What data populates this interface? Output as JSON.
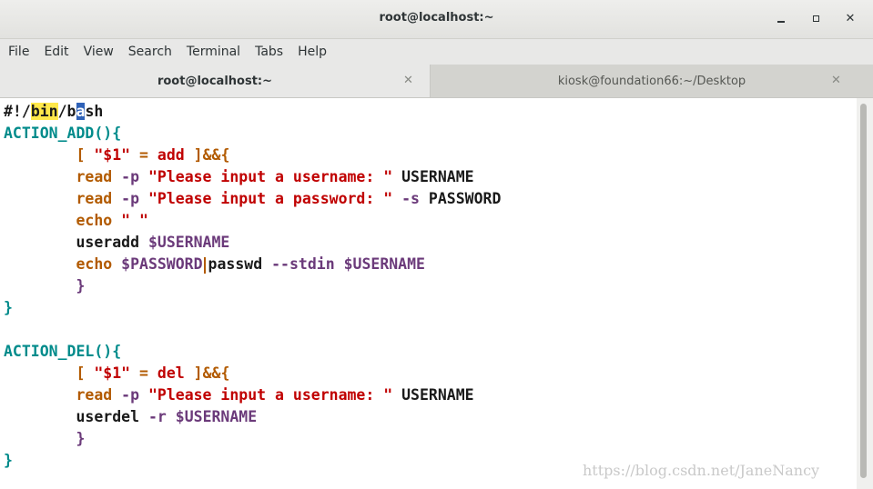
{
  "window": {
    "title": "root@localhost:~",
    "controls": {
      "minimize": "minimize-icon",
      "maximize": "maximize-icon",
      "close": "close-icon"
    }
  },
  "menu": [
    "File",
    "Edit",
    "View",
    "Search",
    "Terminal",
    "Tabs",
    "Help"
  ],
  "tabs": [
    {
      "label": "root@localhost:~",
      "active": true
    },
    {
      "label": "kiosk@foundation66:~/Desktop",
      "active": false
    }
  ],
  "code_lines": [
    [
      {
        "t": "#!/",
        "c": "black"
      },
      {
        "t": "bin",
        "c": "bin"
      },
      {
        "t": "/b",
        "c": "black"
      },
      {
        "t": "a",
        "c": "cursor"
      },
      {
        "t": "sh",
        "c": "black"
      }
    ],
    [
      {
        "t": "ACTION_ADD(){",
        "c": "teal"
      }
    ],
    [
      {
        "t": "        [ ",
        "c": "orange"
      },
      {
        "t": "\"$1\"",
        "c": "red"
      },
      {
        "t": " = ",
        "c": "orange"
      },
      {
        "t": "add",
        "c": "red"
      },
      {
        "t": " ]&&{",
        "c": "orange"
      }
    ],
    [
      {
        "t": "        read ",
        "c": "orange"
      },
      {
        "t": "-p ",
        "c": "purple"
      },
      {
        "t": "\"Please input a username: \"",
        "c": "red"
      },
      {
        "t": " USERNAME",
        "c": "black"
      }
    ],
    [
      {
        "t": "        read ",
        "c": "orange"
      },
      {
        "t": "-p ",
        "c": "purple"
      },
      {
        "t": "\"Please input a password: \"",
        "c": "red"
      },
      {
        "t": " -s ",
        "c": "purple"
      },
      {
        "t": "PASSWORD",
        "c": "black"
      }
    ],
    [
      {
        "t": "        echo ",
        "c": "orange"
      },
      {
        "t": "\" \"",
        "c": "red"
      }
    ],
    [
      {
        "t": "        useradd ",
        "c": "black"
      },
      {
        "t": "$USERNAME",
        "c": "purple"
      }
    ],
    [
      {
        "t": "        echo ",
        "c": "orange"
      },
      {
        "t": "$PASSWORD",
        "c": "purple"
      },
      {
        "t": "|",
        "c": "caret"
      },
      {
        "t": "passwd ",
        "c": "black"
      },
      {
        "t": "--stdin ",
        "c": "purple"
      },
      {
        "t": "$USERNAME",
        "c": "purple"
      }
    ],
    [
      {
        "t": "        }",
        "c": "purple"
      }
    ],
    [
      {
        "t": "}",
        "c": "teal"
      }
    ],
    [
      {
        "t": "",
        "c": "black"
      }
    ],
    [
      {
        "t": "ACTION_DEL(){",
        "c": "teal"
      }
    ],
    [
      {
        "t": "        [ ",
        "c": "orange"
      },
      {
        "t": "\"$1\"",
        "c": "red"
      },
      {
        "t": " = ",
        "c": "orange"
      },
      {
        "t": "del",
        "c": "red"
      },
      {
        "t": " ]&&{",
        "c": "orange"
      }
    ],
    [
      {
        "t": "        read ",
        "c": "orange"
      },
      {
        "t": "-p ",
        "c": "purple"
      },
      {
        "t": "\"Please input a username: \"",
        "c": "red"
      },
      {
        "t": " USERNAME",
        "c": "black"
      }
    ],
    [
      {
        "t": "        userdel ",
        "c": "black"
      },
      {
        "t": "-r ",
        "c": "purple"
      },
      {
        "t": "$USERNAME",
        "c": "purple"
      }
    ],
    [
      {
        "t": "        }",
        "c": "purple"
      }
    ],
    [
      {
        "t": "}",
        "c": "teal"
      }
    ]
  ],
  "watermark": "https://blog.csdn.net/JaneNancy",
  "colors": {
    "teal": "#008b8b",
    "orange": "#b25a00",
    "red": "#c00000",
    "purple": "#6b3a7a",
    "highlight": "#ffe84a",
    "cursor": "#2f62b8"
  }
}
